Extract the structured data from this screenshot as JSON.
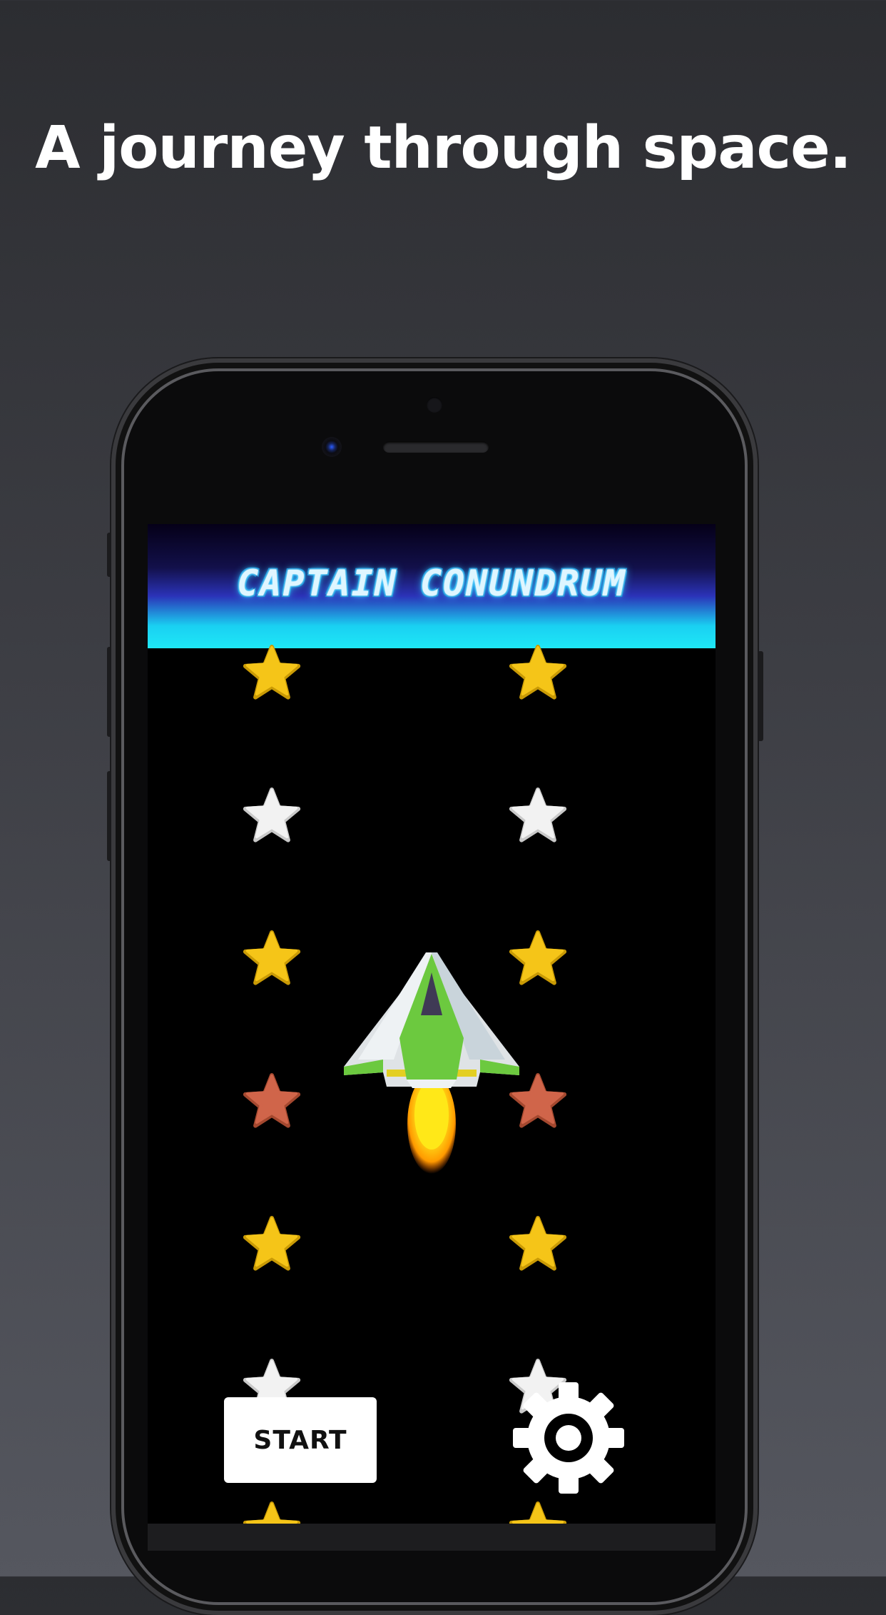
{
  "headline": "A journey through space.",
  "game": {
    "title": "CAPTAIN CONUNDRUM",
    "start_label": "START",
    "settings_icon": "gear-icon",
    "ship_icon": "spaceship-icon"
  },
  "colors": {
    "star_gold": "#f5c518",
    "star_white": "#f2f2f2",
    "star_red": "#d0654a",
    "banner_cyan": "#1ee8f7",
    "ship_green": "#6cc93f"
  },
  "star_rows": [
    {
      "left": "gold",
      "right": "gold"
    },
    {
      "left": "white",
      "right": "white"
    },
    {
      "left": "gold",
      "right": "gold"
    },
    {
      "left": "red",
      "right": "red"
    },
    {
      "left": "gold",
      "right": "gold"
    },
    {
      "left": "white",
      "right": "white"
    },
    {
      "left": "gold",
      "right": "gold"
    }
  ]
}
